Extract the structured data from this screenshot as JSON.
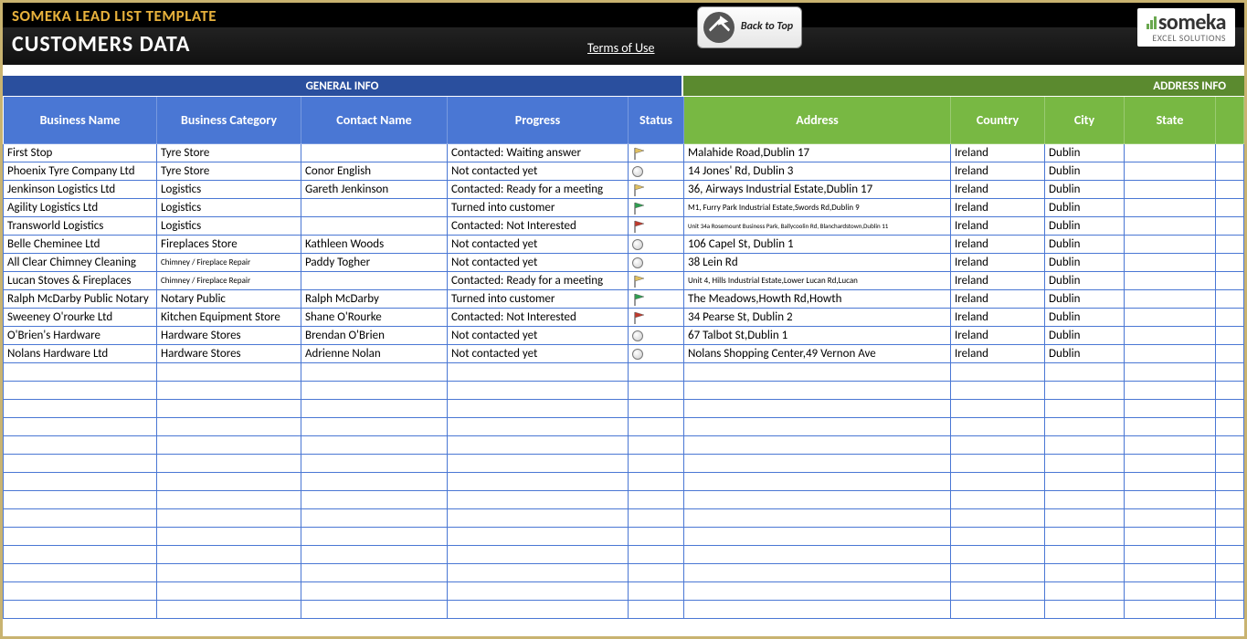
{
  "header": {
    "title": "SOMEKA LEAD LIST TEMPLATE",
    "subtitle": "CUSTOMERS DATA",
    "terms": "Terms of Use",
    "backToTop": "Back to Top",
    "logoMain": "someka",
    "logoSub": "EXCEL SOLUTIONS"
  },
  "sections": {
    "general": "GENERAL INFO",
    "address": "ADDRESS INFO"
  },
  "columns": {
    "businessName": "Business Name",
    "businessCategory": "Business Category",
    "contactName": "Contact Name",
    "progress": "Progress",
    "status": "Status",
    "address": "Address",
    "country": "Country",
    "city": "City",
    "state": "State"
  },
  "rows": [
    {
      "bn": "First Stop",
      "bc": "Tyre Store",
      "cn": "",
      "pr": "Contacted: Waiting answer",
      "st": "flag-yellow",
      "ad": "Malahide Road,Dublin 17",
      "co": "Ireland",
      "ci": "Dublin",
      "sta": ""
    },
    {
      "bn": "Phoenix Tyre Company Ltd",
      "bc": "Tyre Store",
      "cn": "Conor English",
      "pr": "Not contacted yet",
      "st": "circle",
      "ad": "14 Jones' Rd, Dublin 3",
      "co": "Ireland",
      "ci": "Dublin",
      "sta": ""
    },
    {
      "bn": "Jenkinson Logistics Ltd",
      "bc": "Logistics",
      "cn": "Gareth Jenkinson",
      "pr": "Contacted: Ready for a meeting",
      "st": "flag-yellow",
      "ad": "36, Airways Industrial Estate,Dublin 17",
      "co": "Ireland",
      "ci": "Dublin",
      "sta": ""
    },
    {
      "bn": "Agility Logistics Ltd",
      "bc": "Logistics",
      "cn": "",
      "pr": "Turned into customer",
      "st": "flag-green",
      "ad": "M1, Furry Park Industrial Estate,Swords Rd,Dublin 9",
      "co": "Ireland",
      "ci": "Dublin",
      "sta": "",
      "adclass": "small"
    },
    {
      "bn": "Transworld Logistics",
      "bc": "Logistics",
      "cn": "",
      "pr": "Contacted: Not Interested",
      "st": "flag-red",
      "ad": "Unit 34a Rosemount Business Park, Ballycoolin Rd, Blanchardstown,Dublin 11",
      "co": "Ireland",
      "ci": "Dublin",
      "sta": "",
      "adclass": "tiny"
    },
    {
      "bn": "Belle Cheminee Ltd",
      "bc": "Fireplaces Store",
      "cn": "Kathleen Woods",
      "pr": "Not contacted yet",
      "st": "circle",
      "ad": "106 Capel St, Dublin 1",
      "co": "Ireland",
      "ci": "Dublin",
      "sta": ""
    },
    {
      "bn": "All Clear Chimney Cleaning",
      "bc": "Chimney / Fireplace Repair",
      "cn": "Paddy Togher",
      "pr": "Not contacted yet",
      "st": "circle",
      "ad": "38 Lein Rd",
      "co": "Ireland",
      "ci": "Dublin",
      "sta": "",
      "bcclass": "small"
    },
    {
      "bn": "Lucan Stoves & Fireplaces",
      "bc": "Chimney / Fireplace Repair",
      "cn": "",
      "pr": "Contacted: Ready for a meeting",
      "st": "flag-yellow",
      "ad": "Unit 4, Hills Industrial Estate,Lower Lucan Rd,Lucan",
      "co": "Ireland",
      "ci": "Dublin",
      "sta": "",
      "bcclass": "small",
      "adclass": "small"
    },
    {
      "bn": "Ralph McDarby Public Notary",
      "bc": "Notary Public",
      "cn": "Ralph McDarby",
      "pr": "Turned into customer",
      "st": "flag-green",
      "ad": "The Meadows,Howth Rd,Howth",
      "co": "Ireland",
      "ci": "Dublin",
      "sta": ""
    },
    {
      "bn": "Sweeney O'rourke Ltd",
      "bc": "Kitchen Equipment Store",
      "cn": "Shane O'Rourke",
      "pr": "Contacted: Not Interested",
      "st": "flag-red",
      "ad": "34 Pearse St, Dublin 2",
      "co": "Ireland",
      "ci": "Dublin",
      "sta": ""
    },
    {
      "bn": "O'Brien's Hardware",
      "bc": "Hardware Stores",
      "cn": "Brendan O'Brien",
      "pr": "Not contacted yet",
      "st": "circle",
      "ad": "67 Talbot St,Dublin 1",
      "co": "Ireland",
      "ci": "Dublin",
      "sta": ""
    },
    {
      "bn": "Nolans Hardware Ltd",
      "bc": "Hardware Stores",
      "cn": "Adrienne Nolan",
      "pr": "Not contacted yet",
      "st": "circle",
      "ad": "Nolans Shopping Center,49 Vernon Ave",
      "co": "Ireland",
      "ci": "Dublin",
      "sta": ""
    }
  ],
  "emptyRows": 14,
  "statusIcons": {
    "flag-yellow": "#e0c060",
    "flag-green": "#2e9e4f",
    "flag-red": "#c0392b"
  }
}
